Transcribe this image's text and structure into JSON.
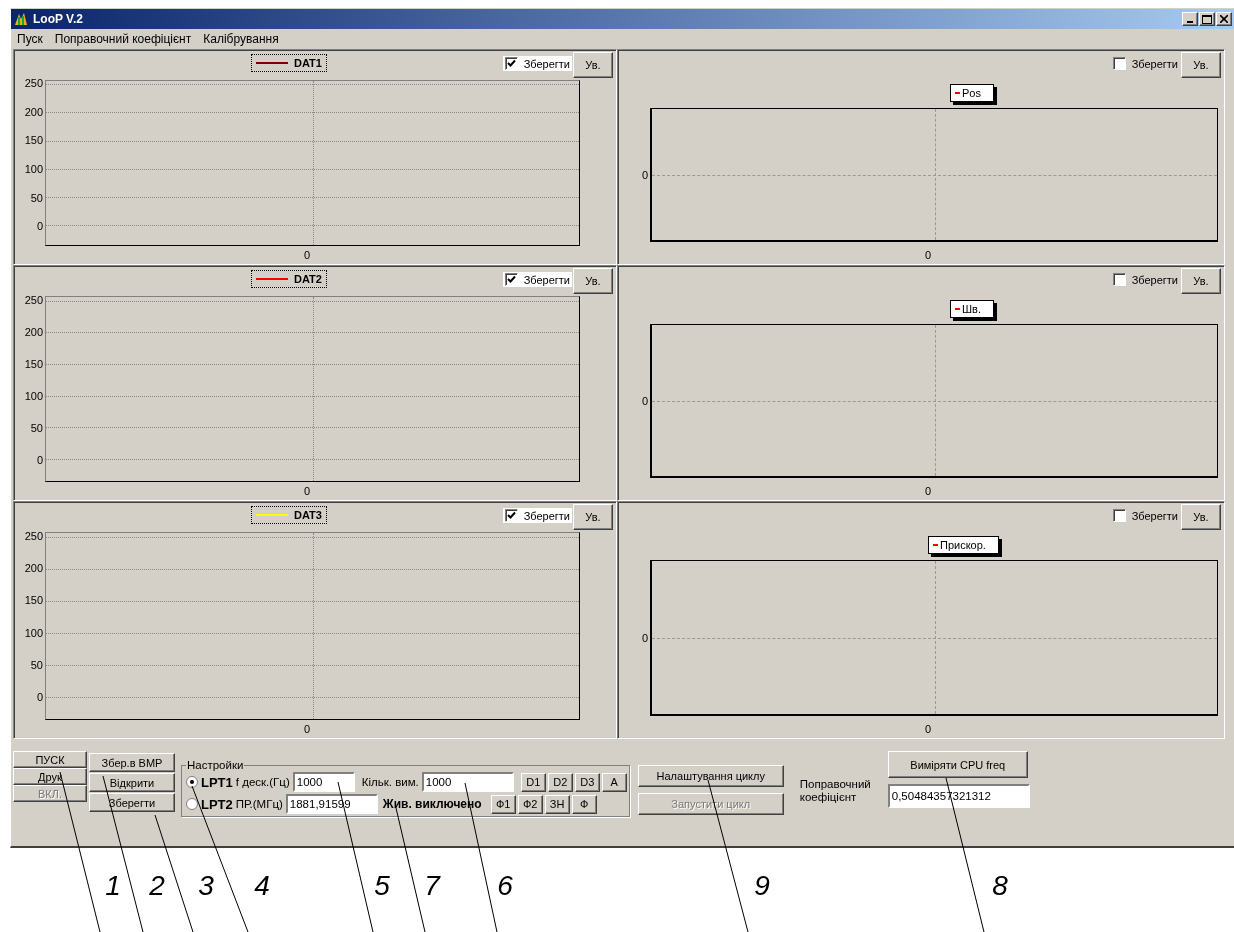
{
  "window": {
    "title": "LooP V.2"
  },
  "menu": [
    "Пуск",
    "Поправочний коефіцієнт",
    "Калібрування"
  ],
  "left_charts": [
    {
      "legend": "DAT1",
      "color": "#800000",
      "save_label": "Зберегти",
      "save_checked": true,
      "zoom_label": "Ув.",
      "y_ticks": [
        "250",
        "200",
        "150",
        "100",
        "50",
        "0"
      ],
      "x_tick": "0"
    },
    {
      "legend": "DAT2",
      "color": "#ff0000",
      "save_label": "Зберегти",
      "save_checked": true,
      "zoom_label": "Ув.",
      "y_ticks": [
        "250",
        "200",
        "150",
        "100",
        "50",
        "0"
      ],
      "x_tick": "0"
    },
    {
      "legend": "DAT3",
      "color": "#ffff00",
      "save_label": "Зберегти",
      "save_checked": true,
      "zoom_label": "Ув.",
      "y_ticks": [
        "250",
        "200",
        "150",
        "100",
        "50",
        "0"
      ],
      "x_tick": "0"
    }
  ],
  "right_charts": [
    {
      "legend": "Pos",
      "save_label": "Зберегти",
      "save_checked": false,
      "zoom_label": "Ув.",
      "y_tick": "0",
      "x_tick": "0"
    },
    {
      "legend": "Шв.",
      "save_label": "Зберегти",
      "save_checked": false,
      "zoom_label": "Ув.",
      "y_tick": "0",
      "x_tick": "0"
    },
    {
      "legend": "Прискор.",
      "save_label": "Зберегти",
      "save_checked": false,
      "zoom_label": "Ув.",
      "y_tick": "0",
      "x_tick": "0"
    }
  ],
  "run_buttons": [
    {
      "label": "ПУСК",
      "disabled": false
    },
    {
      "label": "Друк",
      "disabled": false
    },
    {
      "label": "ВКЛ.",
      "disabled": true
    }
  ],
  "file_buttons": [
    {
      "label": "Збер.в BMP",
      "disabled": false
    },
    {
      "label": "Відкрити",
      "disabled": false
    },
    {
      "label": "Зберегти",
      "disabled": false
    }
  ],
  "settings": {
    "title": "Настройки",
    "ports": [
      {
        "label": "LPT1",
        "selected": true,
        "field_label": "f деск.(Гц)",
        "value": "1000"
      },
      {
        "label": "LPT2",
        "selected": false,
        "field_label": "ПР.(МГц)",
        "value": "1881,91599"
      }
    ],
    "count_label": "Кільк. вим.",
    "count_value": "1000",
    "power_status": "Жив. виключено",
    "channel_buttons": [
      [
        "D1",
        "D2",
        "D3",
        "A"
      ],
      [
        "Ф1",
        "Ф2",
        "ЗН",
        "Ф"
      ]
    ]
  },
  "cycle_buttons": [
    {
      "label": "Налаштування циклу",
      "disabled": false
    },
    {
      "label": "Запустити цикл",
      "disabled": true
    }
  ],
  "correction": {
    "label": "Поправочний коефіцієнт",
    "button": "Виміряти CPU freq",
    "value": "0,50484357321312"
  },
  "callouts": [
    "1",
    "2",
    "3",
    "4",
    "5",
    "7",
    "6",
    "9",
    "8"
  ]
}
